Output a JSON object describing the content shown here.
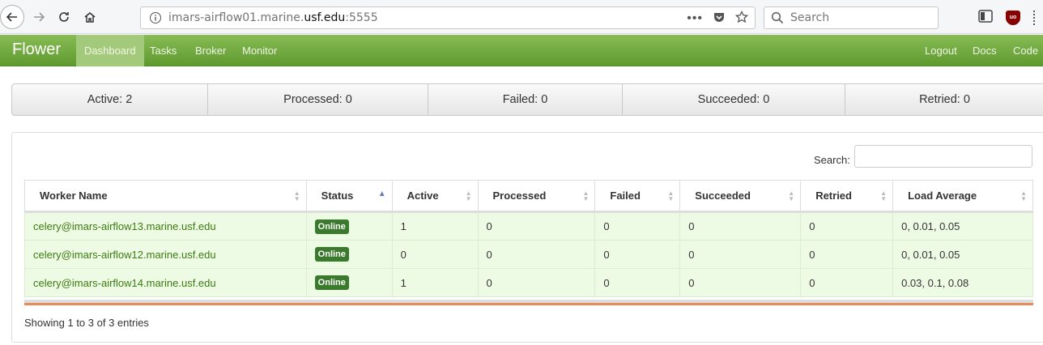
{
  "browser": {
    "url_prefix": "imars-airflow01.marine.",
    "url_domain": "usf.edu",
    "url_suffix": ":5555",
    "search_placeholder": "Search",
    "ublock_label": "uo"
  },
  "navbar": {
    "brand": "Flower",
    "items": [
      "Dashboard",
      "Tasks",
      "Broker",
      "Monitor"
    ],
    "right_items": [
      "Logout",
      "Docs",
      "Code"
    ]
  },
  "summary": {
    "active": "Active: 2",
    "processed": "Processed: 0",
    "failed": "Failed: 0",
    "succeeded": "Succeeded: 0",
    "retried": "Retried: 0"
  },
  "table": {
    "search_label": "Search:",
    "search_value": "",
    "columns": [
      "Worker Name",
      "Status",
      "Active",
      "Processed",
      "Failed",
      "Succeeded",
      "Retried",
      "Load Average"
    ],
    "rows": [
      {
        "name": "celery@imars-airflow13.marine.usf.edu",
        "status": "Online",
        "active": "1",
        "processed": "0",
        "failed": "0",
        "succeeded": "0",
        "retried": "0",
        "load": "0, 0.01, 0.05"
      },
      {
        "name": "celery@imars-airflow12.marine.usf.edu",
        "status": "Online",
        "active": "0",
        "processed": "0",
        "failed": "0",
        "succeeded": "0",
        "retried": "0",
        "load": "0, 0.01, 0.05"
      },
      {
        "name": "celery@imars-airflow14.marine.usf.edu",
        "status": "Online",
        "active": "1",
        "processed": "0",
        "failed": "0",
        "succeeded": "0",
        "retried": "0",
        "load": "0.03, 0.1, 0.08"
      }
    ],
    "info": "Showing 1 to 3 of 3 entries"
  }
}
